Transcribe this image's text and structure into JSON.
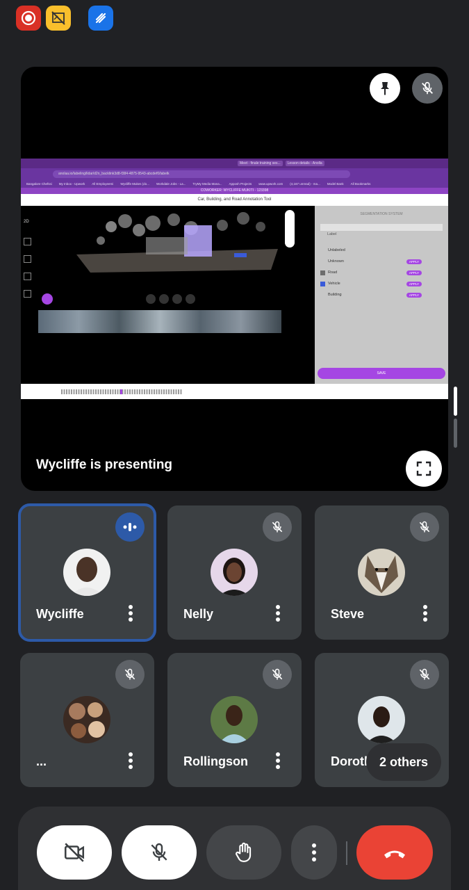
{
  "presentation": {
    "label": "Wycliffe is presenting",
    "shared_screen": {
      "tabs": [
        "Meet - finale training ses...",
        "Lesson details - Anolla"
      ],
      "url": "anolaa.io/labeling/lidar/d2n_backlink3d8-f384-4875-9543-abcdef0/labelk",
      "bookmarks": [
        "Bangalore Chefssi",
        "My Inbox - Upwork",
        "All Employeemi",
        "Wycliffe Mukes (do...",
        "Workdale Jobs - La...",
        "TryMy Media Mana...",
        "Apposh Projects",
        "www.upwork.com",
        "(4,167 unread) - ma...",
        "Model Bank",
        "All Bookmarks"
      ],
      "banner": "COWORKER: WYCLIFFE MUKITI - 123398",
      "app_title": "Car, Building, and Road Annotation Tool",
      "panel_title": "SEGMENTATION SYSTEM",
      "panel_label": "Label",
      "labels": [
        {
          "name": "Unlabeled",
          "apply": false,
          "color": "#c7c7c7"
        },
        {
          "name": "Unknown",
          "apply": true,
          "color": "#c7c7c7"
        },
        {
          "name": "Road",
          "apply": true,
          "color": "#6d6d6d"
        },
        {
          "name": "Vehicle",
          "apply": true,
          "color": "#3a5bd9"
        },
        {
          "name": "Building",
          "apply": true,
          "color": "#c7c7c7"
        }
      ],
      "apply_label": "APPLY",
      "save_label": "SAVE",
      "toolbar_label": "2D"
    }
  },
  "participants": [
    {
      "name": "Wycliffe",
      "speaking": true
    },
    {
      "name": "Nelly",
      "muted": true
    },
    {
      "name": "Steve",
      "muted": true
    },
    {
      "name": "...",
      "muted": true
    },
    {
      "name": "Rollingson",
      "muted": true
    },
    {
      "name": "Dorothy",
      "muted": true
    }
  ],
  "others_chip": "2 others",
  "colors": {
    "background": "#202124",
    "tile": "#3c4043",
    "active_border": "#2d5aa8",
    "hangup": "#ea4335",
    "record": "#d93025",
    "warning": "#f9bf2c",
    "blue_app": "#1a73e8"
  }
}
